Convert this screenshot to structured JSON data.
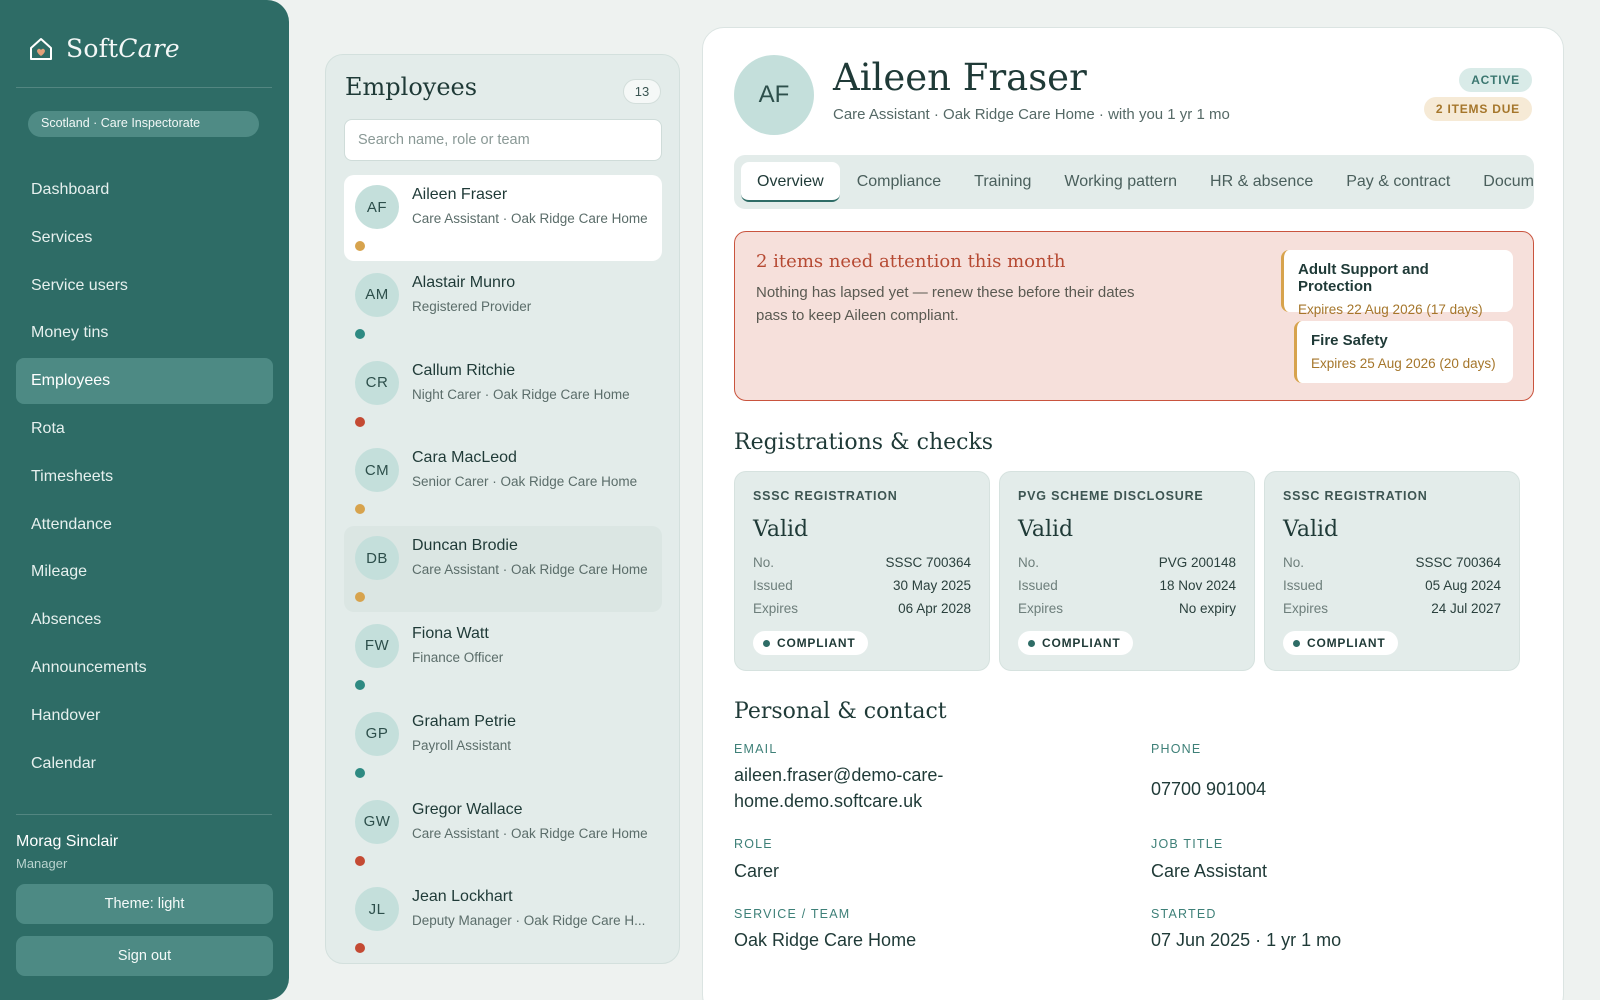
{
  "brand": {
    "name_part1": "Soft",
    "name_part2": "Care"
  },
  "region": "Scotland · Care Inspectorate",
  "nav": [
    {
      "label": "Dashboard",
      "active": false
    },
    {
      "label": "Services",
      "active": false
    },
    {
      "label": "Service users",
      "active": false
    },
    {
      "label": "Money tins",
      "active": false
    },
    {
      "label": "Employees",
      "active": true
    },
    {
      "label": "Rota",
      "active": false
    },
    {
      "label": "Timesheets",
      "active": false
    },
    {
      "label": "Attendance",
      "active": false
    },
    {
      "label": "Mileage",
      "active": false
    },
    {
      "label": "Absences",
      "active": false
    },
    {
      "label": "Announcements",
      "active": false
    },
    {
      "label": "Handover",
      "active": false
    },
    {
      "label": "Calendar",
      "active": false
    }
  ],
  "user": {
    "name": "Morag Sinclair",
    "role": "Manager"
  },
  "theme_button": "Theme: light",
  "signout_button": "Sign out",
  "employees_panel": {
    "title": "Employees",
    "count": "13",
    "search_placeholder": "Search name, role or team",
    "items": [
      {
        "initials": "AF",
        "name": "Aileen Fraser",
        "subtitle": "Care Assistant · Oak Ridge Care Home",
        "status": "amber",
        "selected": true
      },
      {
        "initials": "AM",
        "name": "Alastair Munro",
        "subtitle": "Registered Provider",
        "status": "teal"
      },
      {
        "initials": "CR",
        "name": "Callum Ritchie",
        "subtitle": "Night Carer · Oak Ridge Care Home",
        "status": "red"
      },
      {
        "initials": "CM",
        "name": "Cara MacLeod",
        "subtitle": "Senior Carer · Oak Ridge Care Home",
        "status": "amber"
      },
      {
        "initials": "DB",
        "name": "Duncan Brodie",
        "subtitle": "Care Assistant · Oak Ridge Care Home",
        "status": "amber",
        "hovered": true
      },
      {
        "initials": "FW",
        "name": "Fiona Watt",
        "subtitle": "Finance Officer",
        "status": "teal"
      },
      {
        "initials": "GP",
        "name": "Graham Petrie",
        "subtitle": "Payroll Assistant",
        "status": "teal"
      },
      {
        "initials": "GW",
        "name": "Gregor Wallace",
        "subtitle": "Care Assistant · Oak Ridge Care Home",
        "status": "red"
      },
      {
        "initials": "JL",
        "name": "Jean Lockhart",
        "subtitle": "Deputy Manager · Oak Ridge Care H...",
        "status": "red"
      }
    ]
  },
  "status_colors": {
    "amber": "#d7a34d",
    "teal": "#2e8a82",
    "red": "#c44a33"
  },
  "profile": {
    "initials": "AF",
    "name": "Aileen Fraser",
    "subtitle": "Care Assistant · Oak Ridge Care Home · with you 1 yr 1 mo",
    "status_pill": "ACTIVE",
    "due_pill": "2 ITEMS DUE"
  },
  "tabs": [
    "Overview",
    "Compliance",
    "Training",
    "Working pattern",
    "HR & absence",
    "Pay & contract",
    "Documents"
  ],
  "alert": {
    "title": "2 items need attention this month",
    "body": "Nothing has lapsed yet — renew these before their dates pass to keep Aileen compliant.",
    "items": [
      {
        "title": "Adult Support and Protection",
        "expires": "Expires 22 Aug 2026 (17 days)"
      },
      {
        "title": "Fire Safety",
        "expires": "Expires 25 Aug 2026 (20 days)"
      }
    ]
  },
  "registrations": {
    "title": "Registrations & checks",
    "cards": [
      {
        "label": "SSSC REGISTRATION",
        "state": "Valid",
        "no": "SSSC 700364",
        "issued": "30 May 2025",
        "expires": "06 Apr 2028",
        "badge": "COMPLIANT"
      },
      {
        "label": "PVG SCHEME DISCLOSURE",
        "state": "Valid",
        "no": "PVG 200148",
        "issued": "18 Nov 2024",
        "expires": "No expiry",
        "badge": "COMPLIANT"
      },
      {
        "label": "SSSC REGISTRATION",
        "state": "Valid",
        "no": "SSSC 700364",
        "issued": "05 Aug 2024",
        "expires": "24 Jul 2027",
        "badge": "COMPLIANT"
      }
    ],
    "row_labels": {
      "no": "No.",
      "issued": "Issued",
      "expires": "Expires"
    }
  },
  "personal": {
    "title": "Personal & contact",
    "email_label": "EMAIL",
    "email": "aileen.fraser@demo-care-home.demo.softcare.uk",
    "phone_label": "PHONE",
    "phone": "07700 901004",
    "role_label": "ROLE",
    "role": "Carer",
    "job_label": "JOB TITLE",
    "job": "Care Assistant",
    "service_label": "SERVICE / TEAM",
    "service": "Oak Ridge Care Home",
    "started_label": "STARTED",
    "started": "07 Jun 2025 · 1 yr 1 mo"
  }
}
